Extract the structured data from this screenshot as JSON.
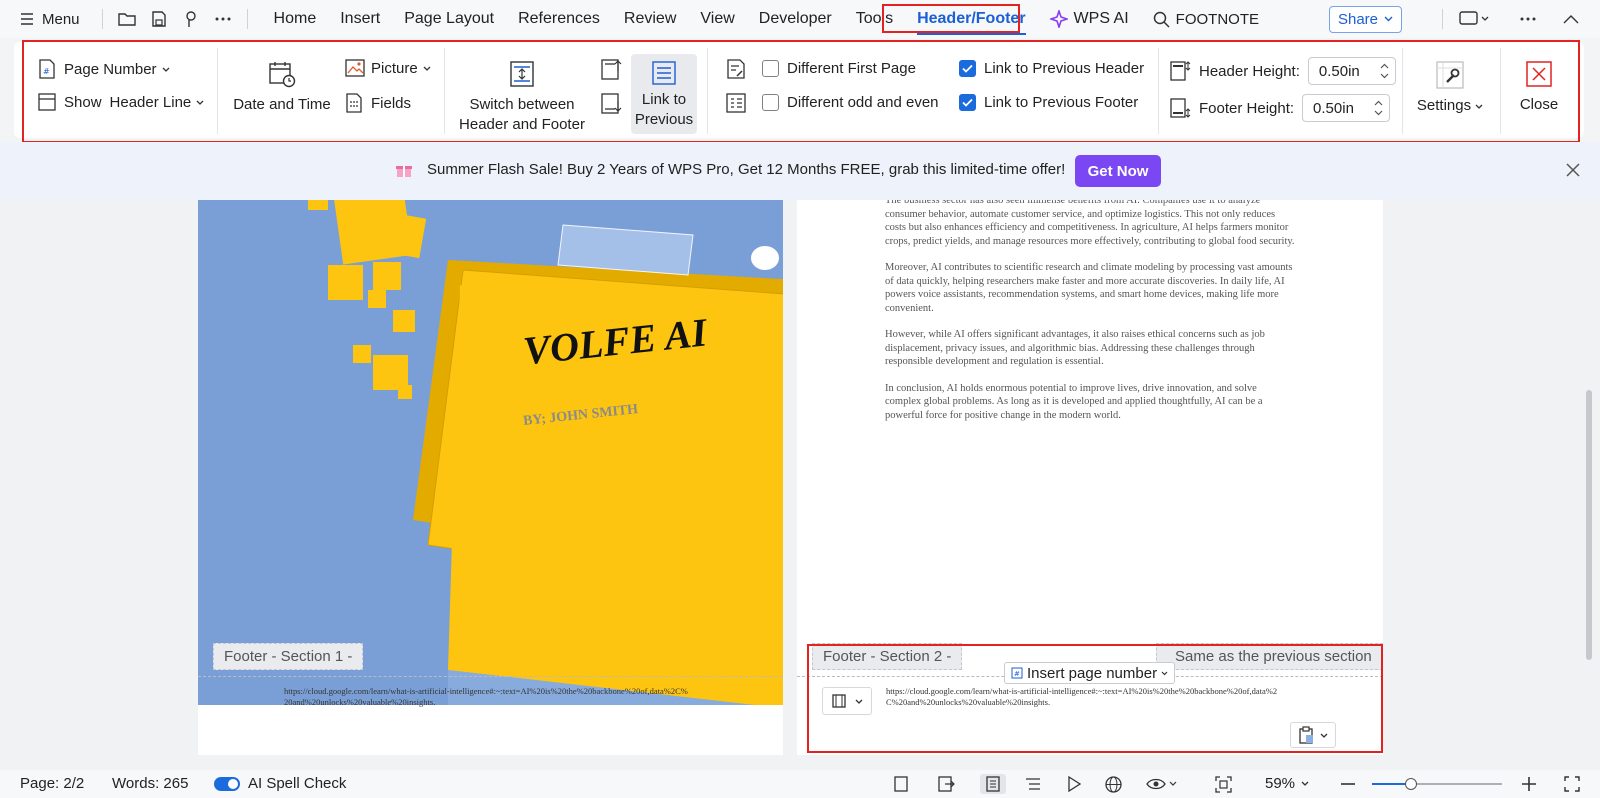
{
  "menubar": {
    "menu_label": "Menu",
    "tabs": [
      "Home",
      "Insert",
      "Page Layout",
      "References",
      "Review",
      "View",
      "Developer",
      "Tools",
      "Header/Footer"
    ],
    "wps_ai": "WPS AI",
    "search_text": "FOOTNOTE",
    "share_label": "Share"
  },
  "ribbon": {
    "page_number": "Page Number",
    "show_label": "Show",
    "header_line": "Header Line",
    "date_time": "Date and Time",
    "picture": "Picture",
    "fields": "Fields",
    "switch_line1": "Switch between",
    "switch_line2": "Header and Footer",
    "link_line1": "Link to",
    "link_line2": "Previous",
    "diff_first": "Different First Page",
    "diff_odd_even": "Different odd and even",
    "link_prev_header": "Link to Previous Header",
    "link_prev_footer": "Link to Previous Footer",
    "header_height_label": "Header Height:",
    "header_height_value": "0.50in",
    "footer_height_label": "Footer Height:",
    "footer_height_value": "0.50in",
    "settings": "Settings",
    "close": "Close",
    "checkbox_state": {
      "diff_first": false,
      "diff_odd_even": false,
      "link_prev_header": true,
      "link_prev_footer": true
    }
  },
  "promo": {
    "text": "Summer Flash Sale! Buy 2 Years of WPS Pro, Get 12 Months FREE, grab this limited-time offer!",
    "button": "Get Now"
  },
  "document": {
    "cover_title": "VOLFE AI",
    "cover_author": "BY; JOHN SMITH",
    "paragraphs": [
      "The business sector has also seen immense benefits from AI. Companies use it to analyze consumer behavior, automate customer service, and optimize logistics. This not only reduces costs but also enhances efficiency and competitiveness. In agriculture, AI helps farmers monitor crops, predict yields, and manage resources more effectively, contributing to global food security.",
      "Moreover, AI contributes to scientific research and climate modeling by processing vast amounts of data quickly, helping researchers make faster and more accurate discoveries. In daily life, AI powers voice assistants, recommendation systems, and smart home devices, making life more convenient.",
      "However, while AI offers significant advantages, it also raises ethical concerns such as job displacement, privacy issues, and algorithmic bias. Addressing these challenges through responsible development and regulation is essential.",
      "In conclusion, AI holds enormous potential to improve lives, drive innovation, and solve complex global problems. As long as it is developed and applied thoughtfully, AI can be a powerful force for positive change in the modern world."
    ],
    "footer_left_tag": "Footer  - Section 1 -",
    "footer_right_tag": "Footer  - Section 2 -",
    "insert_page_number": "Insert page number",
    "same_as_previous": "Same as the previous section",
    "footer_url": "https://cloud.google.com/learn/what-is-artificial-intelligence#:~:text=AI%20is%20the%20backbone%20of,data%2C%20and%20unlocks%20valuable%20insights."
  },
  "statusbar": {
    "page": "Page: 2/2",
    "words": "Words: 265",
    "spell": "AI Spell Check",
    "zoom": "59%"
  },
  "colors": {
    "accent": "#1c5fd6",
    "highlight_outline": "#e32222",
    "promo_button": "#7b47f2",
    "cover_blue": "#7a9fd6",
    "cover_yellow": "#fdc510"
  }
}
